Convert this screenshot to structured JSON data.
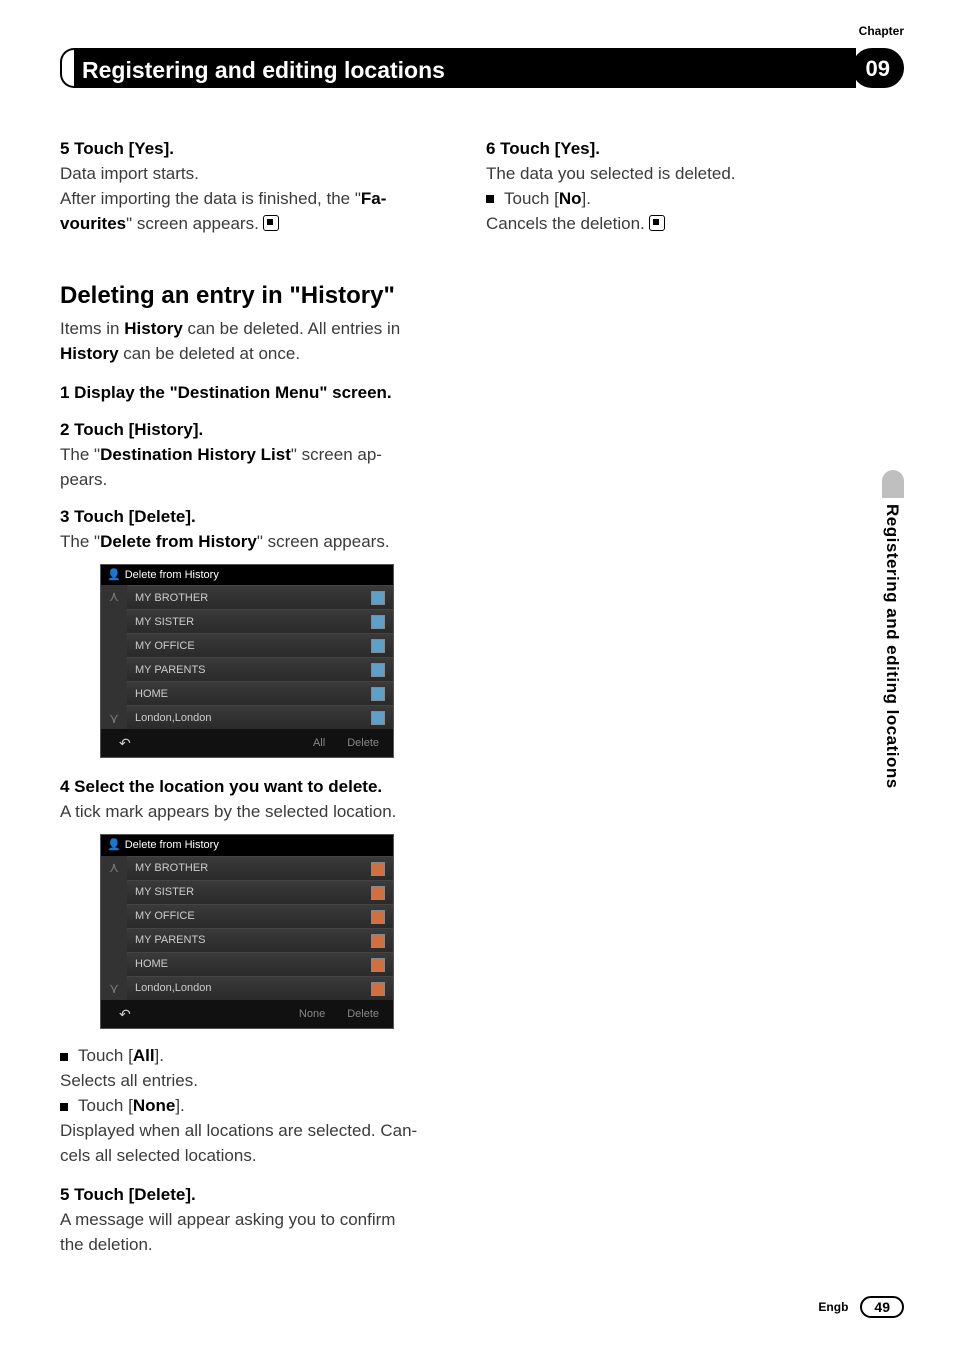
{
  "chapter_label": "Chapter",
  "chapter_number": "09",
  "header_title": "Registering and editing locations",
  "side_tab": "Registering and editing locations",
  "footer_lang": "Engb",
  "page_number": "49",
  "left": {
    "s5_head": "5    Touch [Yes].",
    "s5_l1": "Data import starts.",
    "s5_l2a": "After importing the data is finished, the \"",
    "s5_l2b": "Fa-",
    "s5_l3a": "vourites",
    "s5_l3b": "\" screen appears.",
    "h2": "Deleting an entry in \"History\"",
    "intro_a": "Items in ",
    "intro_b": "History",
    "intro_c": " can be deleted. All entries in",
    "intro_d": "History",
    "intro_e": " can be deleted at once.",
    "s1_head": "1    Display the \"Destination Menu\" screen.",
    "s2_head": "2    Touch [History].",
    "s2_l1a": "The \"",
    "s2_l1b": "Destination History List",
    "s2_l1c": "\" screen ap-",
    "s2_l2": "pears.",
    "s3_head": "3    Touch [Delete].",
    "s3_l1a": "The \"",
    "s3_l1b": "Delete from History",
    "s3_l1c": "\" screen appears.",
    "s4_head": "4    Select the location you want to delete.",
    "s4_l1": "A tick mark appears by the selected location.",
    "bul1_a": "Touch [",
    "bul1_b": "All",
    "bul1_c": "].",
    "bul1_d": "Selects all entries.",
    "bul2_a": "Touch [",
    "bul2_b": "None",
    "bul2_c": "].",
    "bul2_d": "Displayed when all locations are selected. Can-",
    "bul2_e": "cels all selected locations.",
    "s5b_head": "5    Touch [Delete].",
    "s5b_l1": "A message will appear asking you to confirm",
    "s5b_l2": "the deletion."
  },
  "right": {
    "s6_head": "6    Touch [Yes].",
    "s6_l1": "The data you selected is deleted.",
    "bul_a": "Touch [",
    "bul_b": "No",
    "bul_c": "].",
    "bul_d": "Cancels the deletion."
  },
  "screenshot1": {
    "title": "Delete from History",
    "rows": [
      "MY BROTHER",
      "MY SISTER",
      "MY OFFICE",
      "MY PARENTS",
      "HOME",
      "London,London"
    ],
    "footer_mid": "All",
    "footer_right": "Delete"
  },
  "screenshot2": {
    "title": "Delete from History",
    "rows": [
      "MY BROTHER",
      "MY SISTER",
      "MY OFFICE",
      "MY PARENTS",
      "HOME",
      "London,London"
    ],
    "footer_mid": "None",
    "footer_right": "Delete"
  }
}
